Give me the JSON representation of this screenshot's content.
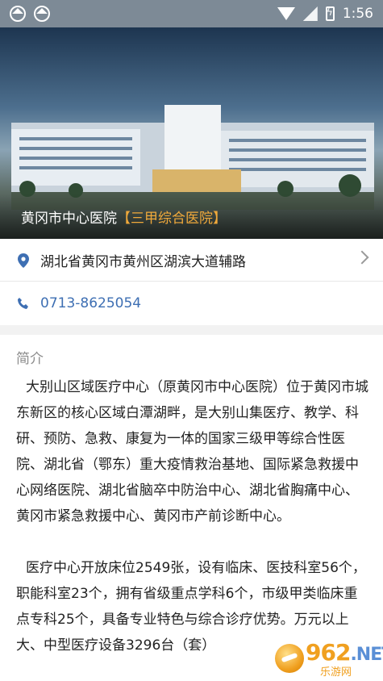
{
  "status_bar": {
    "time": "1:56"
  },
  "hero": {
    "hospital_name": "黄冈市中心医院",
    "grade_tag": "【三甲综合医院】"
  },
  "address": {
    "text": "湖北省黄冈市黄州区湖滨大道辅路"
  },
  "phone": {
    "text": "0713-8625054"
  },
  "intro": {
    "title": "简介",
    "paragraphs": [
      "大别山区域医疗中心（原黄冈市中心医院）位于黄冈市城东新区的核心区域白潭湖畔，是大别山集医疗、教学、科研、预防、急救、康复为一体的国家三级甲等综合性医院、湖北省（鄂东）重大疫情救治基地、国际紧急救援中心网络医院、湖北省脑卒中防治中心、湖北省胸痛中心、黄冈市紧急救援中心、黄冈市产前诊断中心。",
      "医疗中心开放床位2549张，设有临床、医技科室56个，职能科室23个，拥有省级重点学科6个，市级甲类临床重点专科25个，具备专业特色与综合诊疗优势。万元以上大、中型医疗设备3296台（套）"
    ]
  },
  "watermark": {
    "brand": "962",
    "suffix": ".NET",
    "sub": "乐游网"
  },
  "colors": {
    "accent_blue": "#3e6fb3",
    "tag_orange": "#f0a93b"
  }
}
